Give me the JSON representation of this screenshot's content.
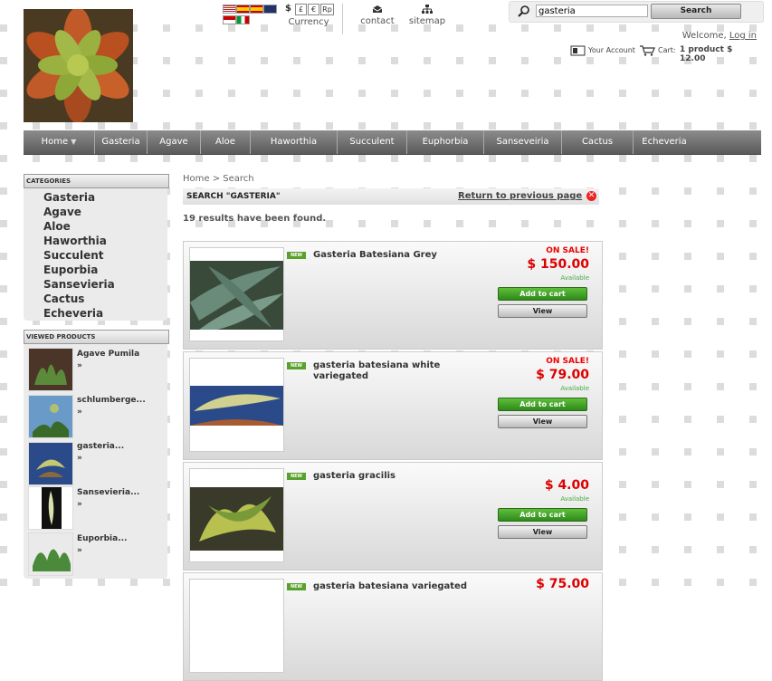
{
  "header": {
    "currency_symbols": [
      "$",
      "£",
      "€",
      "Rp"
    ],
    "currency_label": "Currency",
    "contact_label": "contact",
    "sitemap_label": "sitemap"
  },
  "search": {
    "value": "gasteria",
    "button_label": "Search"
  },
  "account": {
    "welcome_text": "Welcome,",
    "login_link": "Log in",
    "your_account_label": "Your Account",
    "cart_label": "Cart:",
    "cart_summary": "1 product $ 12.00"
  },
  "menu": {
    "items": [
      "Home",
      "Gasteria",
      "Agave",
      "Aloe",
      "Haworthia",
      "Succulent",
      "Euphorbia",
      "Sanseveiria",
      "Cactus",
      "Echeveria"
    ]
  },
  "categories": {
    "title": "CATEGORIES",
    "items": [
      "Gasteria",
      "Agave",
      "Aloe",
      "Haworthia",
      "Succulent",
      "Euporbia",
      "Sansevieria",
      "Cactus",
      "Echeveria"
    ]
  },
  "viewed": {
    "title": "VIEWED PRODUCTS",
    "items": [
      {
        "name": "Agave Pumila",
        "arrow": "»"
      },
      {
        "name": "schlumberge...",
        "arrow": "»"
      },
      {
        "name": "gasteria...",
        "arrow": "»"
      },
      {
        "name": "Sansevieria...",
        "arrow": "»"
      },
      {
        "name": "Euporbia...",
        "arrow": "»"
      }
    ]
  },
  "main": {
    "breadcrumb": "Home > Search",
    "title": "SEARCH \"GASTERIA\"",
    "return_link": "Return to previous page",
    "close_symbol": "✕",
    "results_text": "19 results have been found."
  },
  "products": [
    {
      "badge": "NEW",
      "name": "Gasteria Batesiana Grey",
      "sale": "ON SALE!",
      "price": "$ 150.00",
      "availability": "Available",
      "add_label": "Add to cart",
      "view_label": "View"
    },
    {
      "badge": "NEW",
      "name": "gasteria batesiana white variegated",
      "sale": "ON SALE!",
      "price": "$ 79.00",
      "availability": "Available",
      "add_label": "Add to cart",
      "view_label": "View"
    },
    {
      "badge": "NEW",
      "name": "gasteria gracilis",
      "sale": "",
      "price": "$ 4.00",
      "availability": "Available",
      "add_label": "Add to cart",
      "view_label": "View"
    },
    {
      "badge": "NEW",
      "name": "gasteria batesiana variegated",
      "sale": "",
      "price": "$ 75.00",
      "availability": "",
      "add_label": "",
      "view_label": ""
    }
  ],
  "colors": {
    "price_red": "#dd0000",
    "add_green": "#3a9a22",
    "menu_gray": "#6e6e6e"
  }
}
